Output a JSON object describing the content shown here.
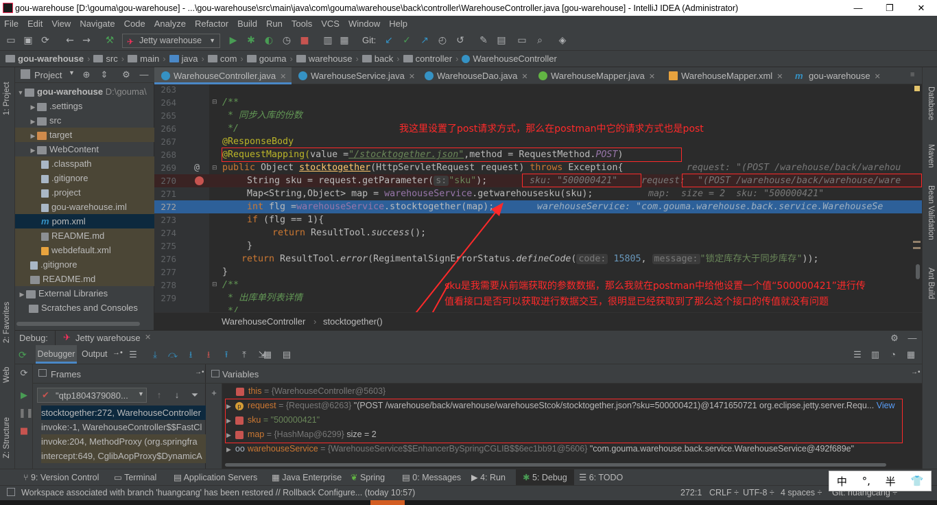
{
  "window": {
    "title": "gou-warehouse [D:\\gouma\\gou-warehouse] - ...\\gou-warehouse\\src\\main\\java\\com\\gouma\\warehouse\\back\\controller\\WarehouseController.java [gou-warehouse] - IntelliJ IDEA (Administrator)",
    "min": "—",
    "max": "❐",
    "close": "✕"
  },
  "menu": [
    "File",
    "Edit",
    "View",
    "Navigate",
    "Code",
    "Analyze",
    "Refactor",
    "Build",
    "Run",
    "Tools",
    "VCS",
    "Window",
    "Help"
  ],
  "toolbar": {
    "run_config": "Jetty warehouse",
    "git_label": "Git:"
  },
  "breadcrumbs": [
    "gou-warehouse",
    "src",
    "main",
    "java",
    "com",
    "gouma",
    "warehouse",
    "back",
    "controller",
    "WarehouseController"
  ],
  "left_strip": {
    "project": "1: Project",
    "favorites": "2: Favorites",
    "web": "Web",
    "structure": "Z: Structure"
  },
  "right_strip": {
    "database": "Database",
    "maven": "Maven",
    "bean": "Bean Validation",
    "ant": "Ant Build"
  },
  "project": {
    "header": "Project",
    "root_name": "gou-warehouse",
    "root_path": "D:\\gouma\\",
    "items": [
      ".settings",
      "src",
      "target",
      "WebContent",
      ".classpath",
      ".gitignore",
      ".project",
      "gou-warehouse.iml",
      "pom.xml",
      "README.md",
      "webdefault.xml"
    ],
    "root_extra": [
      ".gitignore",
      "README.md"
    ],
    "ext_libs": "External Libraries",
    "scratches": "Scratches and Consoles"
  },
  "tabs": [
    "WarehouseController.java",
    "WarehouseService.java",
    "WarehouseDao.java",
    "WarehouseMapper.java",
    "WarehouseMapper.xml",
    "gou-warehouse"
  ],
  "editor": {
    "line_numbers": [
      "263",
      "264",
      "265",
      "266",
      "267",
      "268",
      "269",
      "270",
      "271",
      "272",
      "273",
      "274",
      "275",
      "276",
      "277",
      "278",
      "279"
    ],
    "l264": "/**",
    "l265": " * 同步入库的份数",
    "l266": " */",
    "l267": "@ResponseBody",
    "l268_a": "@RequestMapping(",
    "l268_b": "value =",
    "l268_c": "\"/stocktogether.json\"",
    "l268_d": ",method = RequestMethod.",
    "l268_e": "POST",
    "l268_f": ")",
    "l269_a": "public",
    "l269_b": " Object ",
    "l269_c": "stocktogether",
    "l269_d": "(HttpServletRequest request) ",
    "l269_e": "throws",
    "l269_f": " Exception{",
    "l269_hint": "request: \"(POST /warehouse/back/warehou",
    "l270_a": "String sku = request.getParameter(",
    "l270_s": "s:",
    "l270_b": "\"sku\"",
    "l270_c": ");",
    "l270_hint1": "sku: \"500000421\"",
    "l270_hint2": "request:",
    "l270_hint3": "\"(POST /warehouse/back/warehouse/ware",
    "l271_a": "Map<String,Object> map = ",
    "l271_b": "warehouseService",
    "l271_c": ".getwarehousesku(sku);",
    "l271_hint": "map:  size = 2  sku: \"500000421\"",
    "l272_a": "int",
    "l272_b": " flg =",
    "l272_c": "warehouseService",
    "l272_d": ".stocktogether(map);",
    "l272_hint": "warehouseService: \"com.gouma.warehouse.back.service.WarehouseSe",
    "l273_a": "if",
    "l273_b": " (flg == 1){",
    "l274_a": "return",
    "l274_b": " ResultTool.",
    "l274_c": "success",
    "l274_d": "();",
    "l275": "}",
    "l276_a": "return",
    "l276_b": " ResultTool.",
    "l276_c": "error",
    "l276_d": "(RegimentalSignErrorStatus.",
    "l276_e": "defineCode",
    "l276_f": "(",
    "l276_p1": "code:",
    "l276_n": "15805",
    "l276_g": ",",
    "l276_p2": "message:",
    "l276_s": "\"锁定库存大于同步库存\"",
    "l276_h": "));",
    "l277": "}",
    "l278": "/**",
    "l279": " * 出库单列表详情",
    "l280": " */"
  },
  "notes": {
    "top": "我这里设置了post请求方式，那么在postman中它的请求方式也是post",
    "bottom1": "sku是我需要从前端获取的参数数据，那么我就在postman中给他设置一个值“500000421”进行传",
    "bottom2": "值看接口是否可以获取进行数据交互，很明显已经获取到了那么这个接口的传值就没有问题"
  },
  "editor_crumbs": [
    "WarehouseController",
    "stocktogether()"
  ],
  "debug": {
    "label": "Debug:",
    "config": "Jetty warehouse",
    "tab_debugger": "Debugger",
    "tab_output": "Output",
    "frames_title": "Frames",
    "variables_title": "Variables",
    "thread": "\"qtp1804379080...",
    "frames": [
      "stocktogether:272, WarehouseController",
      "invoke:-1, WarehouseController$$FastCl",
      "invoke:204, MethodProxy (org.springfra",
      "intercept:649, CglibAopProxy$DynamicA"
    ],
    "vars": {
      "this_name": "this",
      "this_val": "= {WarehouseController@5603}",
      "req_name": "request",
      "req_grey": "= {Request@6263}",
      "req_val": "\"(POST /warehouse/back/warehouse/warehouseStcok/stocktogether.json?sku=500000421)@1471650721 org.eclipse.jetty.server.Requ...",
      "req_view": "View",
      "sku_name": "sku",
      "sku_val": "= \"500000421\"",
      "map_name": "map",
      "map_grey": "= {HashMap@6299}",
      "map_val": " size = 2",
      "ws_name": "warehouseService",
      "ws_grey": "= {WarehouseService$$EnhancerBySpringCGLIB$$6ec1bb91@5606}",
      "ws_val": "\"com.gouma.warehouse.back.service.WarehouseService@492f689e\""
    }
  },
  "bottom_tabs": [
    "9: Version Control",
    "Terminal",
    "Application Servers",
    "Java Enterprise",
    "Spring",
    "0: Messages",
    "4: Run",
    "5: Debug",
    "6: TODO"
  ],
  "status": {
    "message": "Workspace associated with branch 'huangcang' has been restored // Rollback Configure... (today 10:57)",
    "position": "272:1",
    "crlf": "CRLF ÷",
    "encoding": "UTF-8 ÷",
    "indent": "4 spaces ÷",
    "git": "Git: huangcang ÷"
  },
  "ime": [
    "中",
    "°,",
    "半",
    "👕"
  ],
  "colors": {
    "accent": "#4a88c7",
    "annotation_red": "#ff2a2a",
    "selection": "#2d6099"
  }
}
